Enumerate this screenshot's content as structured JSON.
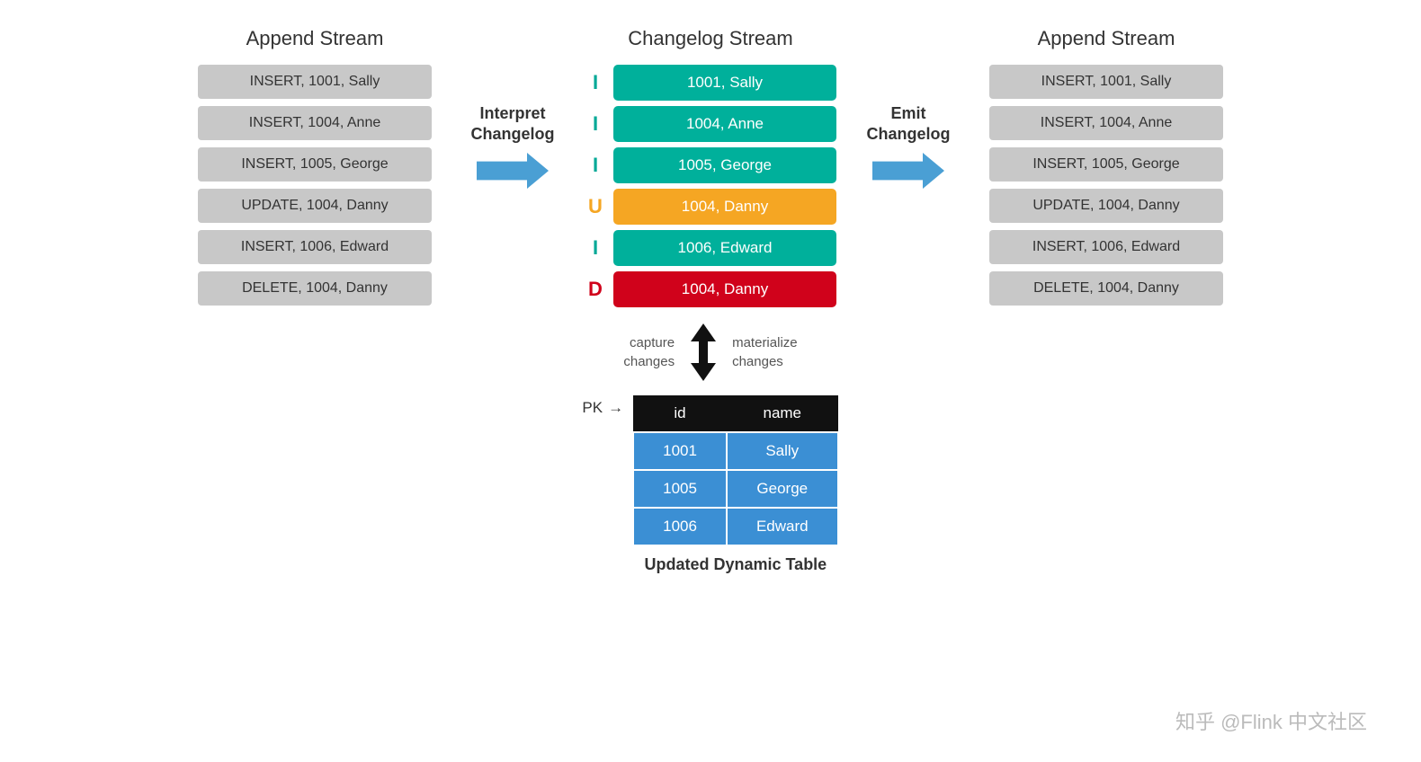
{
  "left_column": {
    "title": "Append Stream",
    "rows": [
      "INSERT, 1001, Sally",
      "INSERT, 1004, Anne",
      "INSERT, 1005, George",
      "UPDATE, 1004, Danny",
      "INSERT, 1006, Edward",
      "DELETE, 1004, Danny"
    ]
  },
  "right_column": {
    "title": "Append Stream",
    "rows": [
      "INSERT, 1001, Sally",
      "INSERT, 1004, Anne",
      "INSERT, 1005, George",
      "UPDATE, 1004, Danny",
      "INSERT, 1006, Edward",
      "DELETE, 1004, Danny"
    ]
  },
  "center_column": {
    "title": "Changelog Stream",
    "rows": [
      {
        "type": "I",
        "label": "insert",
        "text": "1001, Sally"
      },
      {
        "type": "I",
        "label": "insert",
        "text": "1004, Anne"
      },
      {
        "type": "I",
        "label": "insert",
        "text": "1005, George"
      },
      {
        "type": "U",
        "label": "update",
        "text": "1004, Danny"
      },
      {
        "type": "I",
        "label": "insert",
        "text": "1006, Edward"
      },
      {
        "type": "D",
        "label": "delete",
        "text": "1004, Danny"
      }
    ]
  },
  "arrow_left": {
    "label": "Interpret\nChangelog"
  },
  "arrow_right": {
    "label": "Emit\nChangelog"
  },
  "vertical_arrows": {
    "left_label": "capture\nchanges",
    "right_label": "materialize\nchanges"
  },
  "pk_label": "PK",
  "table": {
    "headers": [
      "id",
      "name"
    ],
    "rows": [
      [
        "1001",
        "Sally"
      ],
      [
        "1005",
        "George"
      ],
      [
        "1006",
        "Edward"
      ]
    ]
  },
  "table_caption": "Updated Dynamic Table",
  "watermark": "知乎 @Flink 中文社区"
}
